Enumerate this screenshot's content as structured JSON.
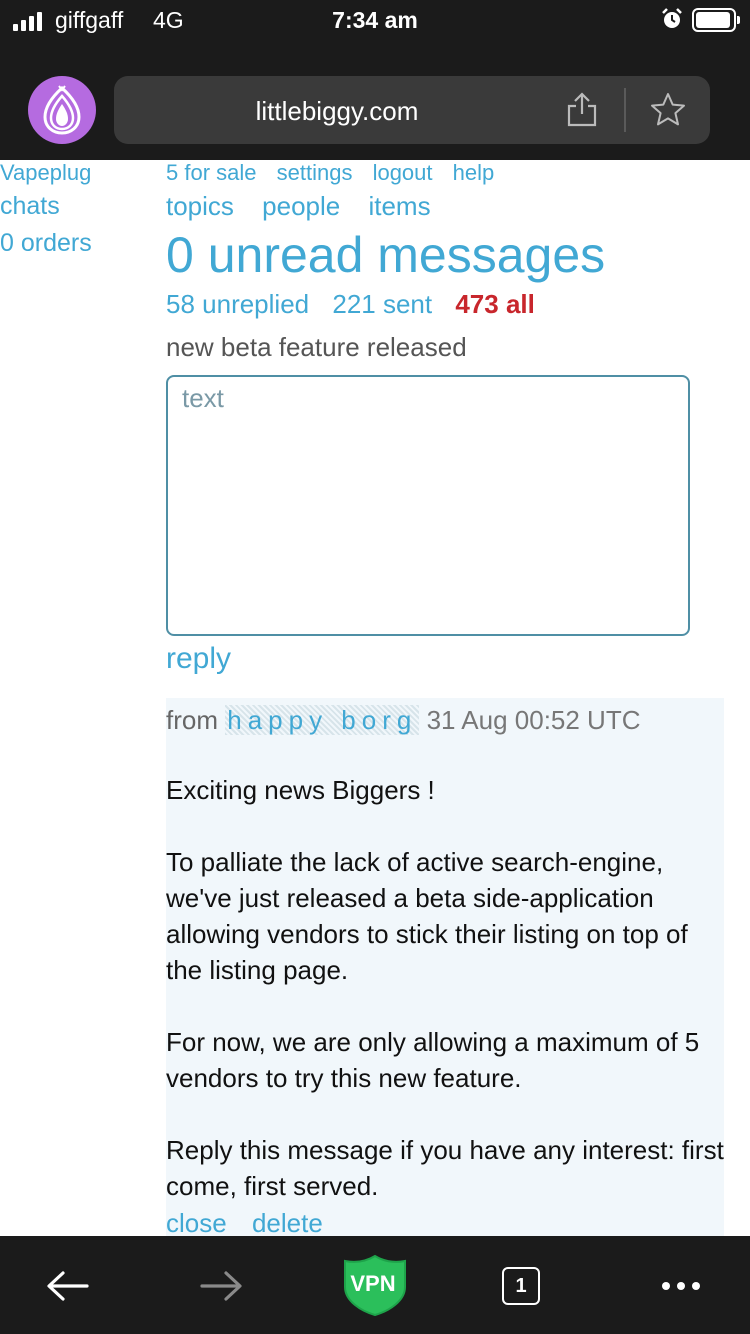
{
  "status_bar": {
    "carrier": "giffgaff",
    "network": "4G",
    "time": "7:34 am",
    "icons": [
      "signal-icon",
      "alarm-icon",
      "battery-icon"
    ]
  },
  "browser": {
    "url": "littlebiggy.com",
    "icons": [
      "onion-icon",
      "share-icon",
      "bookmark-star-icon"
    ]
  },
  "sidebar": {
    "username": "Vapeplug",
    "chats": "chats",
    "orders": "0 orders"
  },
  "nav": {
    "top": [
      "5 for sale",
      "settings",
      "logout",
      "help"
    ],
    "sub": [
      "topics",
      "people",
      "items"
    ]
  },
  "inbox": {
    "title": "0 unread messages",
    "counts": {
      "unreplied": "58 unreplied",
      "sent": "221 sent",
      "all": "473 all"
    }
  },
  "message": {
    "subject": "new beta feature released",
    "reply_placeholder": "text",
    "reply_label": "reply",
    "from_label": "from",
    "sender": "happy borg",
    "date": "31 Aug 00:52 UTC",
    "body": [
      "Exciting news Biggers !",
      "To palliate the lack of active search-engine, we've just released a beta side-application allowing vendors to stick their listing on top of the listing page.",
      "For now, we are only allowing a maximum of 5 vendors to try this new feature.",
      "Reply this message if you have any interest: first come, first served."
    ],
    "close_label": "close",
    "delete_label": "delete"
  },
  "bottom_bar": {
    "vpn_label": "VPN",
    "tab_count": "1",
    "icons": [
      "back-arrow-icon",
      "forward-arrow-icon",
      "vpn-shield-icon",
      "tabs-icon",
      "more-icon"
    ]
  },
  "colors": {
    "link": "#41a8d4",
    "active_count": "#c8262c",
    "onion_bg": "#b56be0",
    "vpn_green": "#2bbf5b",
    "bar_bg": "#1b1b1b"
  }
}
